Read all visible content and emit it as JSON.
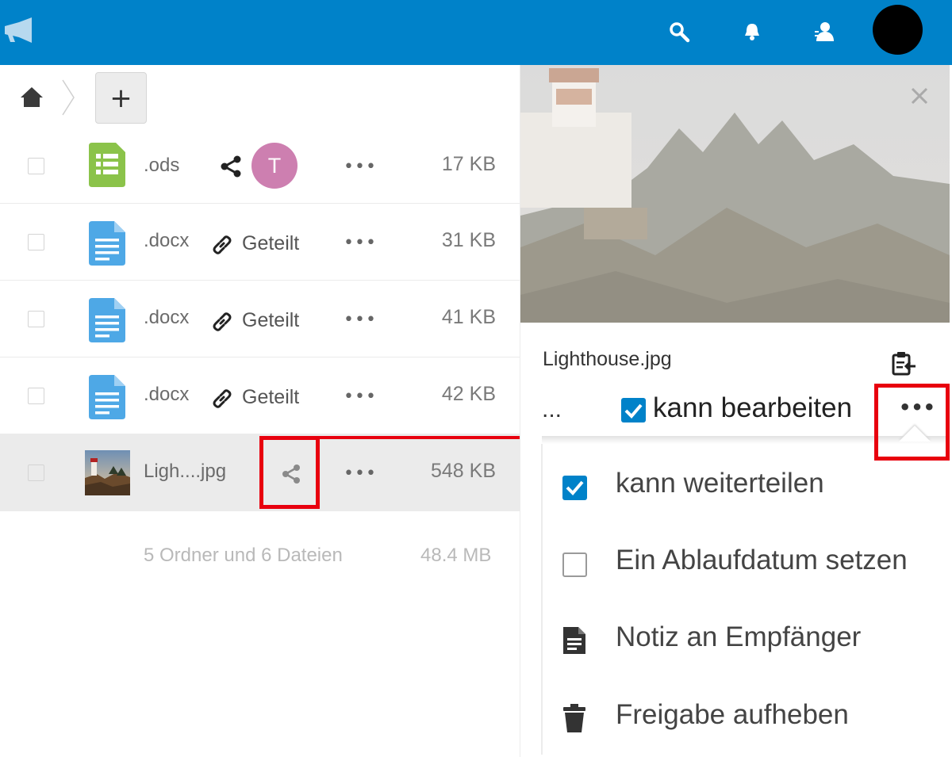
{
  "header": {
    "icons": [
      "megaphone-icon",
      "search-icon",
      "bell-icon",
      "contacts-icon"
    ],
    "brand_color": "#0082c9"
  },
  "breadcrumb": {
    "add_label": "+"
  },
  "files": [
    {
      "name": ".ods",
      "type": "spreadsheet",
      "share": "T",
      "size": "17 KB"
    },
    {
      "name": ".docx",
      "type": "document",
      "share": "Geteilt",
      "size": "31 KB"
    },
    {
      "name": ".docx",
      "type": "document",
      "share": "Geteilt",
      "size": "41 KB"
    },
    {
      "name": ".docx",
      "type": "document",
      "share": "Geteilt",
      "size": "42 KB"
    },
    {
      "name": "Ligh....jpg",
      "type": "image",
      "share": "",
      "size": "548 KB"
    }
  ],
  "actions_label": "•••",
  "summary": {
    "text": "5 Ordner und 6 Dateien",
    "total": "48.4 MB"
  },
  "sidebar": {
    "file_name": "Lighthouse.jpg",
    "share_entry_name": "...",
    "can_edit_label": "kann bearbeiten",
    "more_label": "•••",
    "menu": [
      {
        "label": "kann weiterteilen",
        "icon": "checkbox-checked-icon"
      },
      {
        "label": "Ein Ablaufdatum setzen",
        "icon": "checkbox-empty-icon"
      },
      {
        "label": "Notiz an Empfänger",
        "icon": "note-icon"
      },
      {
        "label": "Freigabe aufheben",
        "icon": "trash-icon"
      }
    ]
  },
  "colors": {
    "highlight": "#e8000e",
    "checkbox": "#0082c9",
    "avatar_t": "#cd7fb0"
  }
}
